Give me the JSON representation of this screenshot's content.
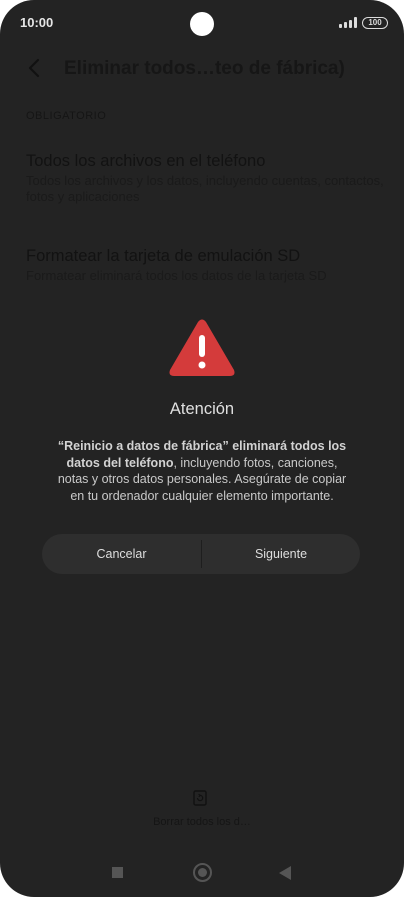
{
  "status_bar": {
    "time": "10:00",
    "battery": "100",
    "icons": [
      "signal-icon",
      "battery-icon"
    ]
  },
  "app_bar": {
    "title": "Eliminar todos…teo de fábrica)",
    "back_icon": "back-arrow-icon"
  },
  "section_label": "OBLIGATORIO",
  "options": [
    {
      "title": "Todos los archivos en el teléfono",
      "subtitle": "Todos los archivos y los datos, incluyendo cuentas, contactos, fotos y aplicaciones"
    },
    {
      "title": "Formatear la tarjeta de emulación SD",
      "subtitle": "Formatear eliminará todos los datos de la tarjeta SD"
    }
  ],
  "dialog": {
    "icon": "warning-icon",
    "accent_color": "#d43b3b",
    "title": "Atención",
    "message_bold": "“Reinicio a datos de fábrica” eliminará todos los datos del teléfono",
    "message_rest": ", incluyendo fotos, canciones, notas y otros datos personales. Asegúrate de copiar en tu ordenador cualquier elemento importante.",
    "cancel_label": "Cancelar",
    "next_label": "Siguiente"
  },
  "bottom_action": {
    "icon": "erase-phone-icon",
    "label": "Borrar todos los d…"
  },
  "nav_bar": {
    "icons": [
      "recents-square-icon",
      "home-circle-icon",
      "back-triangle-icon"
    ]
  }
}
